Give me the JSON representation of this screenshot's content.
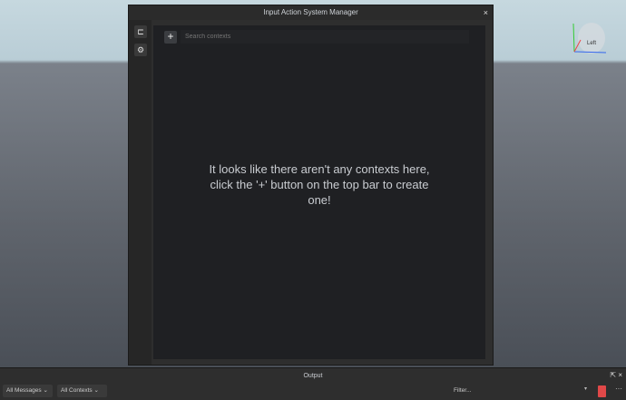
{
  "viewport": {
    "gizmo_label": "Left"
  },
  "window": {
    "title": "Input Action System Manager",
    "close": "×",
    "sidebar": [
      {
        "icon": "tree-icon",
        "glyph": "⊏"
      },
      {
        "icon": "gear-icon",
        "glyph": "⚙"
      }
    ],
    "add_label": "+",
    "search_placeholder": "Search contexts",
    "empty_message": "It looks like there aren't any contexts here, click the '+' button on the top bar to create one!"
  },
  "output": {
    "title": "Output",
    "messages_filter": "All Messages",
    "contexts_filter": "All Contexts",
    "filter_placeholder": "Filter...",
    "more": "···",
    "popout": "⇱",
    "close": "×",
    "caret": "▾",
    "chevron": "⌄"
  }
}
